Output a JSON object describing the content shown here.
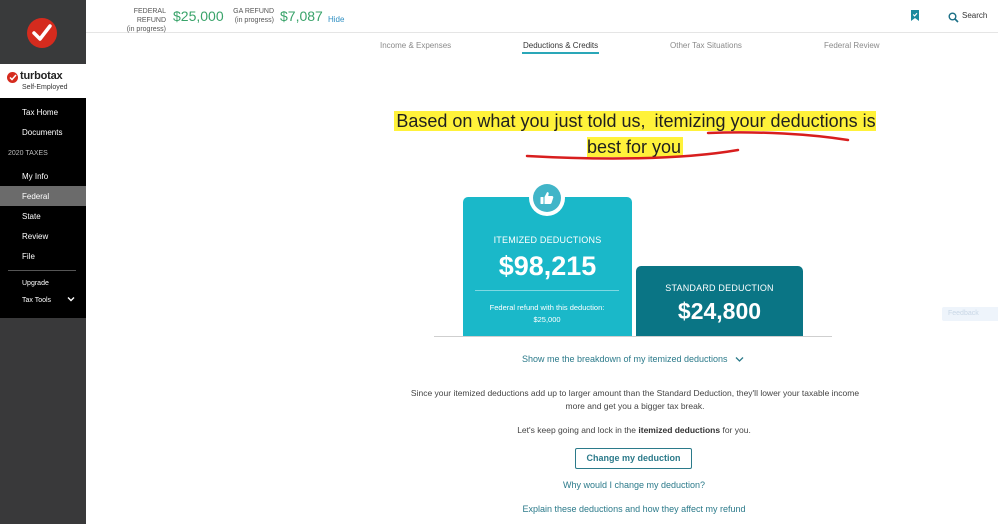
{
  "brand": {
    "name": "turbotax",
    "edition": "Self-Employed",
    "color": "#d52b1e"
  },
  "sidebar": {
    "items": [
      {
        "label": "Tax Home"
      },
      {
        "label": "Documents"
      },
      {
        "label": "2020 TAXES"
      },
      {
        "label": "My Info"
      },
      {
        "label": "Federal",
        "active": true
      },
      {
        "label": "State"
      },
      {
        "label": "Review"
      },
      {
        "label": "File"
      },
      {
        "label": "Upgrade"
      },
      {
        "label": "Tax Tools"
      }
    ]
  },
  "header": {
    "federal": {
      "label_line1": "FEDERAL REFUND",
      "label_line2": "(in progress)",
      "amount": "$25,000"
    },
    "ga": {
      "label_line1": "GA REFUND",
      "label_line2": "(in progress)",
      "amount": "$7,087"
    },
    "hide_label": "Hide",
    "search_label": "Search",
    "accent_color": "#39a36a"
  },
  "tabs": [
    {
      "label": "Income & Expenses"
    },
    {
      "label": "Deductions & Credits",
      "active": true
    },
    {
      "label": "Other Tax Situations"
    },
    {
      "label": "Federal Review"
    }
  ],
  "main": {
    "headline_part1": "Based on what you just told us, ",
    "headline_part2": "itemizing your deductions is best for you",
    "itemized": {
      "title": "ITEMIZED DEDUCTIONS",
      "amount": "$98,215",
      "note_line1": "Federal refund with this deduction:",
      "note_line2": "$25,000",
      "color": "#1ab8c9"
    },
    "standard": {
      "title": "STANDARD DEDUCTION",
      "amount": "$24,800",
      "color": "#0a7585"
    },
    "breakdown_link": "Show me the breakdown of my itemized deductions",
    "explain_line1": "Since your itemized deductions add up to larger amount than the Standard Deduction, they'll lower your taxable income",
    "explain_line2": "more and get you a bigger tax break.",
    "keep_prefix": "Let's keep going and lock in the ",
    "keep_bold": "itemized deductions",
    "keep_suffix": " for you.",
    "change_button": "Change my deduction",
    "why_link": "Why would I change my deduction?",
    "explain_link": "Explain these deductions and how they affect my refund"
  },
  "feedback_label": "Feedback"
}
